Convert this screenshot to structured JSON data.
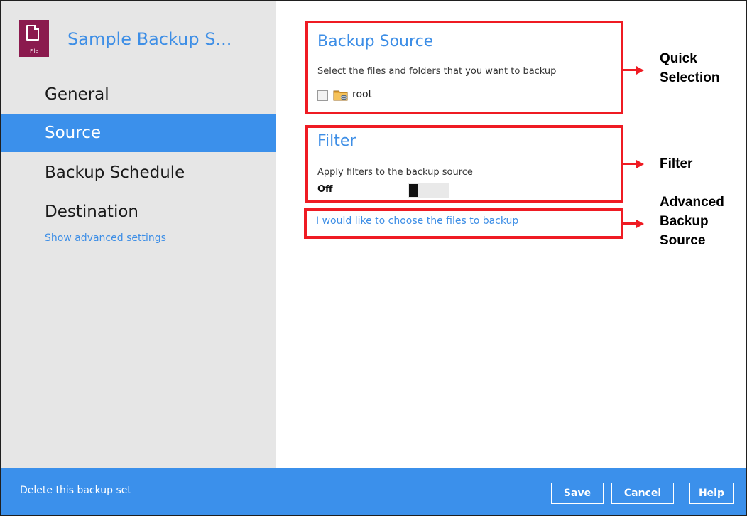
{
  "app": {
    "title": "Sample Backup S...",
    "icon": "file-icon",
    "icon_caption": "File"
  },
  "sidebar": {
    "items": [
      {
        "label": "General",
        "active": false
      },
      {
        "label": "Source",
        "active": true
      },
      {
        "label": "Backup Schedule",
        "active": false
      },
      {
        "label": "Destination",
        "active": false
      }
    ],
    "advanced_link": "Show advanced settings"
  },
  "backup_source": {
    "title": "Backup Source",
    "description": "Select the files and folders that you want to backup",
    "items": [
      {
        "label": "root",
        "checked": false,
        "icon": "folder-network-icon"
      }
    ]
  },
  "filter": {
    "title": "Filter",
    "description": "Apply filters to the backup source",
    "state_label": "Off",
    "enabled": false
  },
  "advanced_source": {
    "link": "I would like to choose the files to backup"
  },
  "annotations": {
    "quick_selection": [
      "Quick",
      "Selection"
    ],
    "filter": [
      "Filter"
    ],
    "advanced_backup_source": [
      "Advanced",
      "Backup",
      "Source"
    ]
  },
  "footer": {
    "delete_link": "Delete this backup set",
    "buttons": {
      "save": "Save",
      "cancel": "Cancel",
      "help": "Help"
    }
  },
  "colors": {
    "accent": "#3b90eb",
    "link": "#3d8ee6",
    "annotation_red": "#ef1b23",
    "sidebar_bg": "#e6e6e6",
    "icon_bg": "#8b1a4e"
  }
}
